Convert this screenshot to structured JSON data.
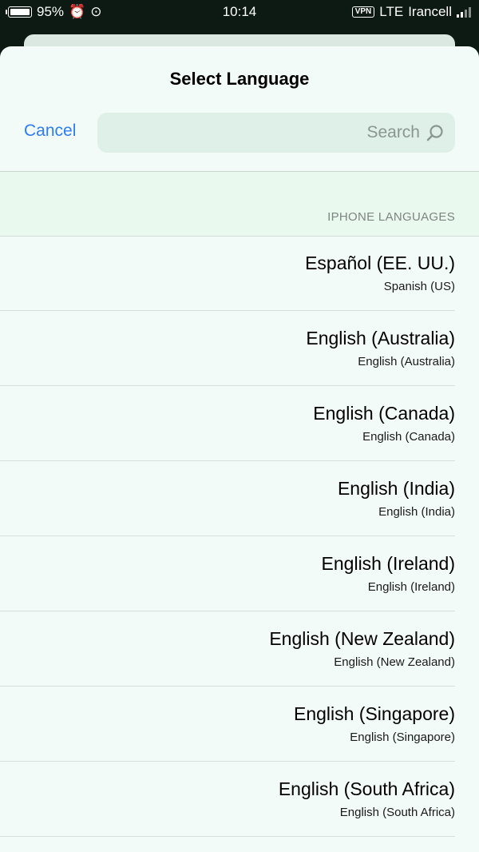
{
  "status_bar": {
    "battery": "95%",
    "time": "10:14",
    "network": "LTE",
    "vpn": "VPN",
    "carrier": "Irancell"
  },
  "sheet": {
    "title": "Select Language",
    "search_placeholder": "Search",
    "cancel_label": "Cancel",
    "section_header": "IPHONE LANGUAGES",
    "languages": [
      {
        "name": "Español (EE. UU.)",
        "subtitle": "Spanish (US)"
      },
      {
        "name": "English (Australia)",
        "subtitle": "English (Australia)"
      },
      {
        "name": "English (Canada)",
        "subtitle": "English (Canada)"
      },
      {
        "name": "English (India)",
        "subtitle": "English (India)"
      },
      {
        "name": "English (Ireland)",
        "subtitle": "English (Ireland)"
      },
      {
        "name": "English (New Zealand)",
        "subtitle": "English (New Zealand)"
      },
      {
        "name": "English (Singapore)",
        "subtitle": "English (Singapore)"
      },
      {
        "name": "English (South Africa)",
        "subtitle": "English (South Africa)"
      }
    ]
  },
  "colors": {
    "accent": "#2f7df3",
    "sheet_background": "#f2fbf7",
    "search_background": "#dff0e8"
  }
}
